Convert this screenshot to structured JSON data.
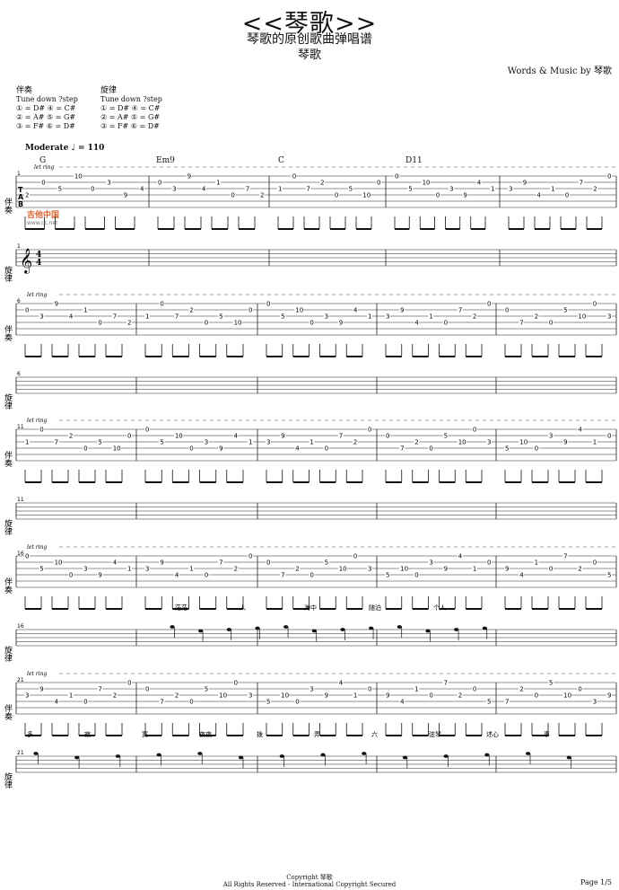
{
  "header": {
    "title": "<<琴歌>>",
    "subtitle": "琴歌的原创歌曲弹唱谱",
    "composer": "琴歌",
    "credit": "Words & Music by 琴歌"
  },
  "tuning": {
    "accompaniment": {
      "label": "伴奏",
      "note": "Tune down ?step",
      "rows": [
        "① = D#  ④ = C#",
        "② = A#  ⑤ = G#",
        "③ = F#  ⑥ = D#"
      ]
    },
    "melody": {
      "label": "旋律",
      "note": "Tune down ?step",
      "rows": [
        "① = D#  ④ = C#",
        "② = A#  ⑤ = G#",
        "③ = F#  ⑥ = D#"
      ]
    }
  },
  "tempo": {
    "label": "Moderate",
    "bpm": "= 110"
  },
  "chords": [
    "G",
    "Em9",
    "C",
    "D11"
  ],
  "staff_labels": {
    "accompaniment": "伴奏",
    "melody": "旋律",
    "let_ring": "let ring"
  },
  "systems": [
    {
      "measure_start": "1",
      "lyrics": []
    },
    {
      "measure_start": "6",
      "lyrics": []
    },
    {
      "measure_start": "11",
      "lyrics": []
    },
    {
      "measure_start": "16",
      "lyrics": [
        "茫茫",
        "人",
        "海中",
        "随泊",
        "个人"
      ]
    },
    {
      "measure_start": "21",
      "lyrics": [
        "多",
        "寂",
        "寞",
        "夜夜",
        "拨",
        "弄",
        "六",
        "弦琴",
        "述心",
        "事"
      ]
    }
  ],
  "watermark": {
    "name": "吉他中国",
    "url": "www.cc.net"
  },
  "footer": {
    "copyright": "Copyright  琴歌",
    "rights": "All Rights Reserved - International Copyright Secured",
    "page": "Page 1/5"
  }
}
